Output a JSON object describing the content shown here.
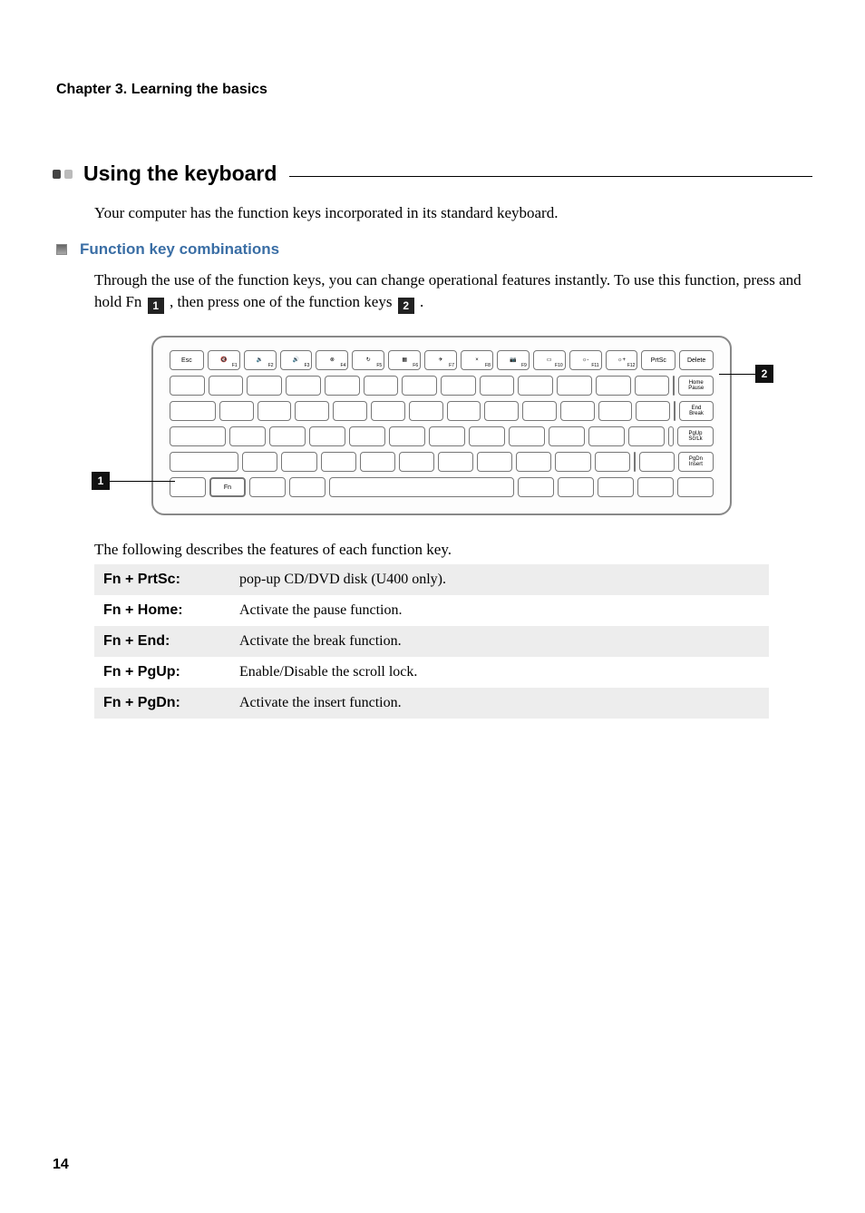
{
  "chapter": "Chapter 3. Learning the basics",
  "section_title": "Using the keyboard",
  "intro": "Your computer has the function keys incorporated in its standard keyboard.",
  "sub_title": "Function key combinations",
  "sub_para_a": "Through the use of the function keys, you can change operational features instantly. To use this function, press and hold Fn ",
  "sub_para_b": " , then press one of the function keys ",
  "sub_para_c": " .",
  "callout_1": "1",
  "callout_2": "2",
  "keys": {
    "esc": "Esc",
    "prtsc": "PrtSc",
    "delete": "Delete",
    "home": "Home\nPause",
    "end": "End\nBreak",
    "pgup": "PgUp\nScrLk",
    "pgdn": "PgDn\nInsert",
    "fn": "Fn",
    "frow": [
      "F1",
      "F2",
      "F3",
      "F4",
      "F5",
      "F6",
      "F7",
      "F8",
      "F9",
      "F10",
      "F11",
      "F12"
    ],
    "ficons": [
      "🔇",
      "🔉",
      "🔊",
      "⊗",
      "↻",
      "▦",
      "✈",
      "×",
      "📷",
      "▭",
      "☼-",
      "☼+"
    ]
  },
  "desc_intro": "The following describes the features of each function key.",
  "fk_rows": [
    {
      "k": "Fn + PrtSc:",
      "d": "pop-up CD/DVD disk (U400 only)."
    },
    {
      "k": "Fn + Home:",
      "d": "Activate the pause function."
    },
    {
      "k": "Fn + End:",
      "d": "Activate the break function."
    },
    {
      "k": "Fn + PgUp:",
      "d": "Enable/Disable the scroll lock."
    },
    {
      "k": "Fn + PgDn:",
      "d": "Activate the insert function."
    }
  ],
  "page_number": "14"
}
